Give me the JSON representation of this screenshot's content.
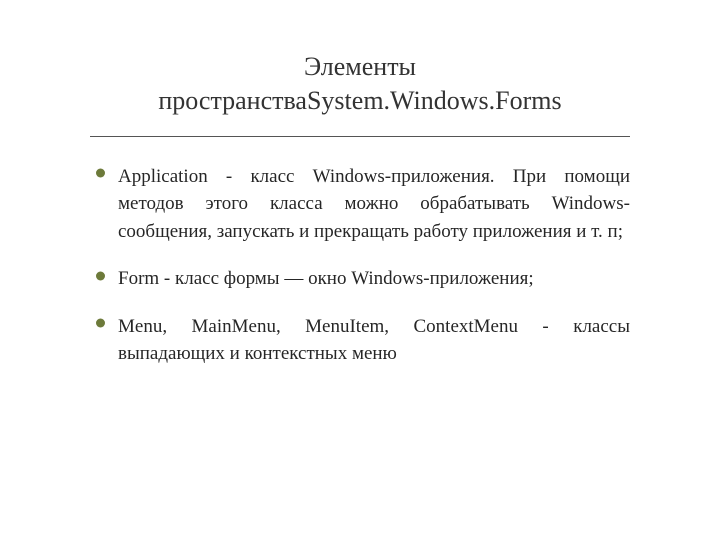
{
  "title_line1": "Элементы",
  "title_line2": "пространстваSystem.Windows.Forms",
  "bullets": [
    "Application - класс Windows-приложения. При помощи методов этого класса можно обрабатывать Windows-сообщения, запускать и прекращать работу приложения и т. п;",
    "Form - класс формы — окно Windows-приложения;",
    "Menu, MainMenu, MenuItem, ContextMenu - классы выпадающих и контекстных меню"
  ]
}
